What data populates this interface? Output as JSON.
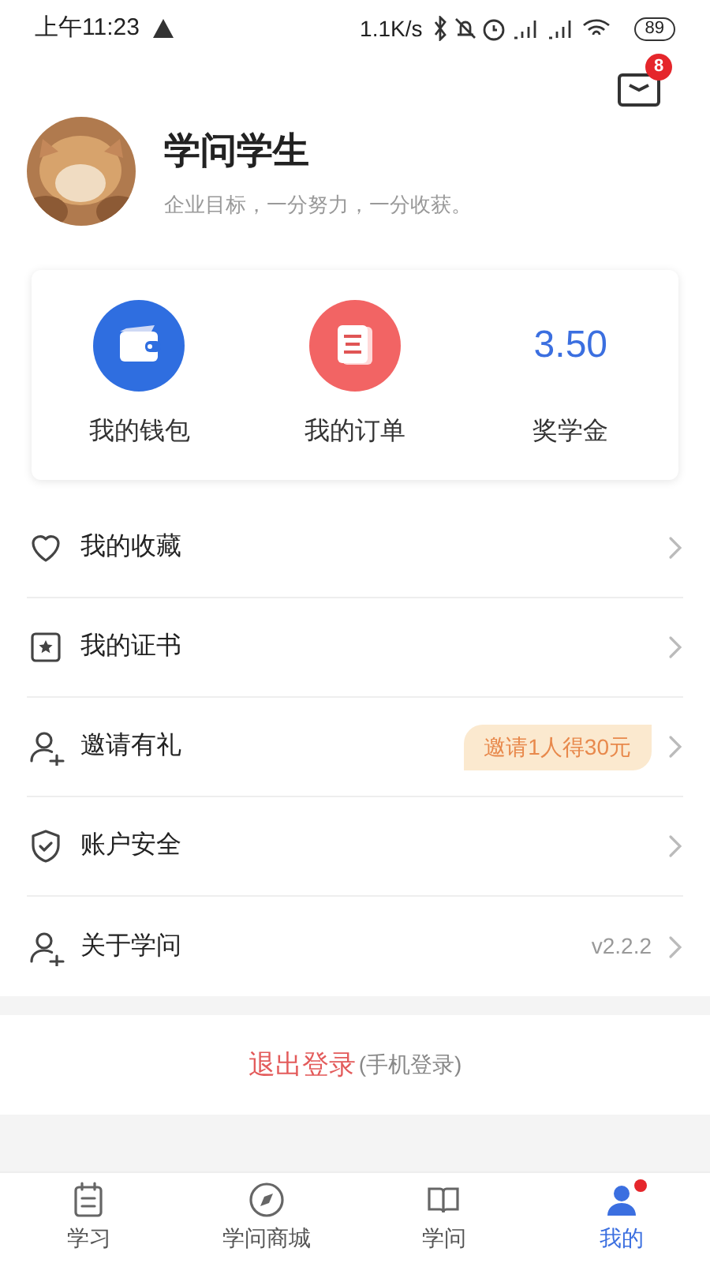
{
  "status_bar": {
    "time": "上午11:23",
    "speed": "1.1K/s",
    "battery": "89"
  },
  "messages": {
    "count": "8"
  },
  "profile": {
    "name": "学问学生",
    "motto": "企业目标，一分努力，一分收获。"
  },
  "shortcuts": [
    {
      "kind": "wallet",
      "label": "我的钱包"
    },
    {
      "kind": "order",
      "label": "我的订单"
    },
    {
      "kind": "value",
      "value": "3.50",
      "label": "奖学金"
    }
  ],
  "menu": [
    {
      "kind": "heart",
      "label": "我的收藏"
    },
    {
      "kind": "certificate",
      "label": "我的证书"
    },
    {
      "kind": "user",
      "label": "邀请有礼",
      "badge": "邀请1人得30元"
    },
    {
      "kind": "shield",
      "label": "账户安全"
    },
    {
      "kind": "user",
      "label": "关于学问",
      "note": "v2.2.2"
    }
  ],
  "logout": {
    "label": "退出登录",
    "note": "(手机登录)"
  },
  "tabs": [
    {
      "kind": "notebook",
      "label": "学习",
      "selected": false,
      "dot": false
    },
    {
      "kind": "compass",
      "label": "学问商城",
      "selected": false,
      "dot": false
    },
    {
      "kind": "book",
      "label": "学问",
      "selected": false,
      "dot": false
    },
    {
      "kind": "person",
      "label": "我的",
      "selected": true,
      "dot": true
    }
  ]
}
